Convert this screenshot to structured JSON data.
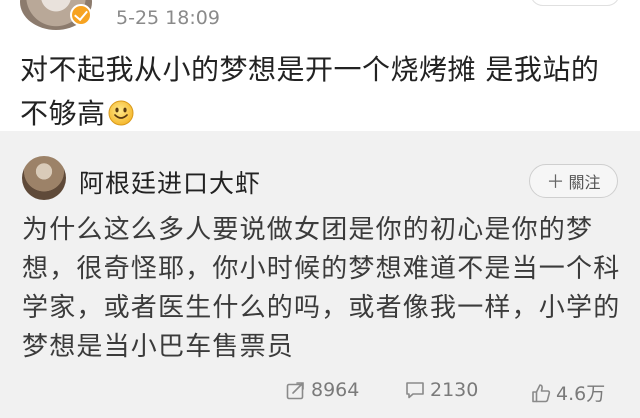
{
  "post": {
    "time": "5-25 18:09",
    "text": "对不起我从小的梦想是开一个烧烤摊 是我站的不够高"
  },
  "retweet": {
    "author": "阿根廷进口大虾",
    "follow_label": "關注",
    "text": "为什么这么多人要说做女团是你的初心是你的梦想，很奇怪耶，你小时候的梦想难道不是当一个科学家，或者医生什么的吗，或者像我一样，小学的梦想是当小巴车售票员"
  },
  "stats": {
    "shares": "8964",
    "comments": "2130",
    "likes": "4.6万"
  },
  "icons": {
    "verified": "verified-badge-icon",
    "emoji": "smiley-icon",
    "share": "share-icon",
    "comment": "comment-icon",
    "like": "thumbs-up-icon"
  },
  "colors": {
    "verified_badge": "#f7a321",
    "card_bg": "#ffffff",
    "retweet_bg": "#f1f1f1",
    "meta_text": "#8a8a8a"
  }
}
